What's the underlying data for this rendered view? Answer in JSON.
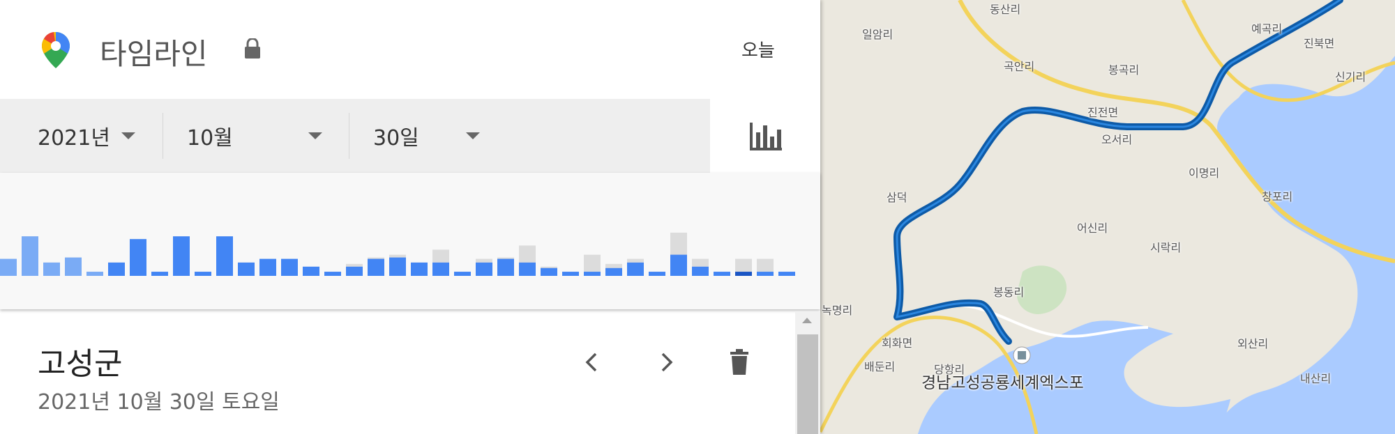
{
  "header": {
    "title": "타임라인",
    "today_label": "오늘",
    "logo_icon": "google-maps-pin-icon",
    "lock_icon": "lock-icon"
  },
  "date_selector": {
    "year": "2021년",
    "month": "10월",
    "day": "30일",
    "chart_icon": "bar-chart-icon"
  },
  "histogram": {
    "bar_color": "#4285f4",
    "dark_bar_color": "#1a55c4",
    "light_bar_color": "#7aabf5",
    "ghost_color": "#dcdcdc",
    "bars": [
      {
        "ghost": 0.37,
        "fill": 0.37,
        "tone": "light"
      },
      {
        "ghost": 0.86,
        "fill": 0.86,
        "tone": "light"
      },
      {
        "ghost": 0.29,
        "fill": 0.29,
        "tone": "light"
      },
      {
        "ghost": 0.4,
        "fill": 0.4,
        "tone": "light"
      },
      {
        "ghost": 0.09,
        "fill": 0.09,
        "tone": "light"
      },
      {
        "ghost": 0.29,
        "fill": 0.29,
        "tone": "normal"
      },
      {
        "ghost": 0.8,
        "fill": 0.8,
        "tone": "normal"
      },
      {
        "ghost": 0.09,
        "fill": 0.09,
        "tone": "normal"
      },
      {
        "ghost": 0.86,
        "fill": 0.86,
        "tone": "normal"
      },
      {
        "ghost": 0.09,
        "fill": 0.09,
        "tone": "normal"
      },
      {
        "ghost": 0.86,
        "fill": 0.86,
        "tone": "normal"
      },
      {
        "ghost": 0.29,
        "fill": 0.29,
        "tone": "normal"
      },
      {
        "ghost": 0.37,
        "fill": 0.37,
        "tone": "normal"
      },
      {
        "ghost": 0.37,
        "fill": 0.37,
        "tone": "normal"
      },
      {
        "ghost": 0.2,
        "fill": 0.2,
        "tone": "normal"
      },
      {
        "ghost": 0.09,
        "fill": 0.09,
        "tone": "normal"
      },
      {
        "ghost": 0.26,
        "fill": 0.2,
        "tone": "normal"
      },
      {
        "ghost": 0.4,
        "fill": 0.37,
        "tone": "normal"
      },
      {
        "ghost": 0.46,
        "fill": 0.4,
        "tone": "normal"
      },
      {
        "ghost": 0.29,
        "fill": 0.29,
        "tone": "normal"
      },
      {
        "ghost": 0.57,
        "fill": 0.29,
        "tone": "normal"
      },
      {
        "ghost": 0.09,
        "fill": 0.09,
        "tone": "normal"
      },
      {
        "ghost": 0.37,
        "fill": 0.29,
        "tone": "normal"
      },
      {
        "ghost": 0.4,
        "fill": 0.37,
        "tone": "normal"
      },
      {
        "ghost": 0.66,
        "fill": 0.29,
        "tone": "normal"
      },
      {
        "ghost": 0.2,
        "fill": 0.17,
        "tone": "normal"
      },
      {
        "ghost": 0.09,
        "fill": 0.09,
        "tone": "normal"
      },
      {
        "ghost": 0.46,
        "fill": 0.09,
        "tone": "normal"
      },
      {
        "ghost": 0.26,
        "fill": 0.17,
        "tone": "normal"
      },
      {
        "ghost": 0.37,
        "fill": 0.29,
        "tone": "normal"
      },
      {
        "ghost": 0.09,
        "fill": 0.09,
        "tone": "normal"
      },
      {
        "ghost": 0.94,
        "fill": 0.46,
        "tone": "normal"
      },
      {
        "ghost": 0.37,
        "fill": 0.2,
        "tone": "normal"
      },
      {
        "ghost": 0.09,
        "fill": 0.09,
        "tone": "normal"
      },
      {
        "ghost": 0.37,
        "fill": 0.09,
        "tone": "dark"
      },
      {
        "ghost": 0.37,
        "fill": 0.09,
        "tone": "normal"
      },
      {
        "ghost": 0.09,
        "fill": 0.09,
        "tone": "normal"
      }
    ]
  },
  "day_detail": {
    "place": "고성군",
    "date_full": "2021년 10월 30일 토요일",
    "prev_icon": "chevron-left-icon",
    "next_icon": "chevron-right-icon",
    "delete_icon": "trash-icon"
  },
  "map": {
    "route_color": "#0d5aa7",
    "water_color": "#aacbff",
    "road_color": "#f3d35b",
    "land_color": "#ebe8df",
    "place_marker_label": "경남고성공룡세계엑스포",
    "labels": [
      "동산리",
      "일암리",
      "곡안리",
      "봉곡리",
      "예곡리",
      "진북면",
      "신기리",
      "진전면",
      "오서리",
      "이명리",
      "창포리",
      "삼덕",
      "어신리",
      "시락리",
      "봉동리",
      "녹명리",
      "회화면",
      "배둔리",
      "당항리",
      "외산리",
      "내산리"
    ]
  }
}
